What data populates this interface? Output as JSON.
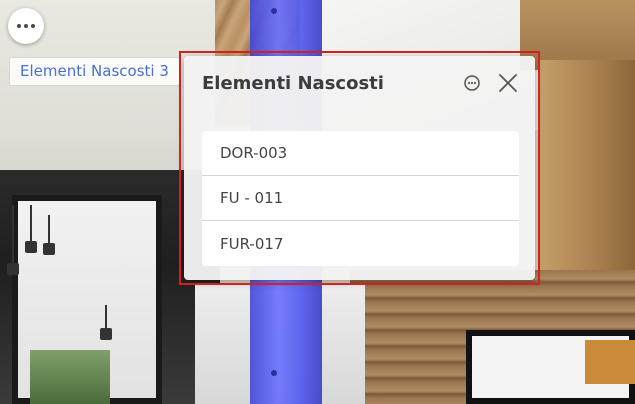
{
  "toolbar": {
    "more_icon": "more-horizontal-icon"
  },
  "hidden_chip": {
    "label": "Elementi Nascosti 3"
  },
  "panel": {
    "title": "Elementi Nascosti",
    "menu_icon": "more-circle-icon",
    "close_icon": "close-icon",
    "items": [
      {
        "label": "DOR-003"
      },
      {
        "label": "FU - 011"
      },
      {
        "label": "FUR-017"
      }
    ]
  },
  "colors": {
    "chip_text": "#4a6fd1",
    "highlight_border": "#d32020",
    "selected_column": "#5058ef"
  }
}
